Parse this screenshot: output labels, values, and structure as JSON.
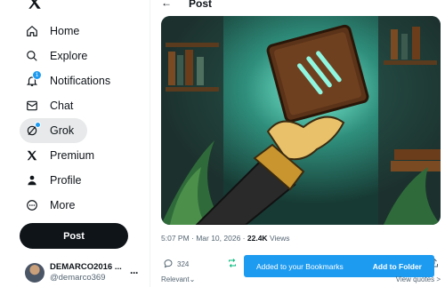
{
  "nav": {
    "items": [
      {
        "label": "Home",
        "icon": "home-icon"
      },
      {
        "label": "Explore",
        "icon": "search-icon"
      },
      {
        "label": "Notifications",
        "icon": "bell-icon",
        "badge": "1"
      },
      {
        "label": "Chat",
        "icon": "chat-icon"
      },
      {
        "label": "Grok",
        "icon": "grok-icon"
      },
      {
        "label": "Premium",
        "icon": "x-icon"
      },
      {
        "label": "Profile",
        "icon": "person-icon"
      },
      {
        "label": "More",
        "icon": "more-circle-icon"
      }
    ],
    "post_label": "Post"
  },
  "account": {
    "name": "DEMARCO2016 ...",
    "handle": "@demarco369",
    "more": "···"
  },
  "header": {
    "back": "←",
    "title": "Post"
  },
  "post": {
    "timestamp": "5:07 PM · Mar 10, 2026 ·",
    "views_count": "22.4K",
    "views_label": "Views",
    "replies": "324",
    "image_alt": "Illustration of a glowing book floating above a cartoon hand in a library"
  },
  "toast": {
    "text": "Added to your Bookmarks",
    "link": "Add to Folder"
  },
  "replies_sort": {
    "label": "Relevant",
    "chevron": "⌄"
  },
  "view_quotes": "View quotes",
  "view_quotes_chevron": ">",
  "colors": {
    "accent": "#1d9bf0",
    "text": "#0f1419",
    "muted": "#536471"
  }
}
